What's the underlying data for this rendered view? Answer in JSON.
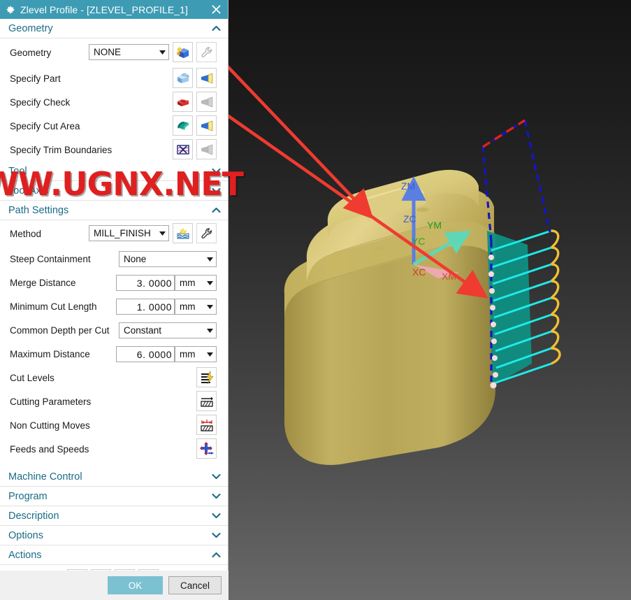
{
  "window": {
    "title": "Zlevel Profile - [ZLEVEL_PROFILE_1]",
    "gear_icon": "gear-icon",
    "close_icon": "close-icon",
    "titlebar_color": "#3d9bb4"
  },
  "watermark": {
    "text": "WW.UGNX.NET",
    "color": "#e01f1f"
  },
  "groups": {
    "geometry": {
      "label": "Geometry",
      "expanded": true,
      "chevron": "chevron-up-icon",
      "geometry_row": {
        "label": "Geometry",
        "value": "NONE",
        "edit_icon": "edit-geometry-icon",
        "wrench_icon": "wrench-icon"
      },
      "specify_rows": [
        {
          "label": "Specify Part",
          "select_icon": "part-body-icon",
          "display_icon": "flashlight-icon",
          "enabled": true
        },
        {
          "label": "Specify Check",
          "select_icon": "check-body-icon",
          "display_icon": "flashlight-icon",
          "enabled": false
        },
        {
          "label": "Specify Cut Area",
          "select_icon": "cut-area-icon",
          "display_icon": "flashlight-icon",
          "enabled": true
        },
        {
          "label": "Specify Trim Boundaries",
          "select_icon": "trim-boundary-icon",
          "display_icon": "flashlight-icon",
          "enabled": false
        }
      ]
    },
    "tool": {
      "label": "Tool",
      "expanded": false,
      "chevron": "chevron-down-icon"
    },
    "tool_axis": {
      "label": "Tool Axis",
      "expanded": false,
      "chevron": "chevron-down-icon"
    },
    "path_settings": {
      "label": "Path Settings",
      "expanded": true,
      "chevron": "chevron-up-icon",
      "method": {
        "label": "Method",
        "value": "MILL_FINISH",
        "edit_icon": "edit-method-icon",
        "wrench_icon": "wrench-icon"
      },
      "fields": [
        {
          "label": "Steep Containment",
          "type": "combo",
          "value": "None"
        },
        {
          "label": "Merge Distance",
          "type": "number",
          "value": "3. 0000",
          "unit": "mm"
        },
        {
          "label": "Minimum Cut Length",
          "type": "number",
          "value": "1. 0000",
          "unit": "mm"
        },
        {
          "label": "Common Depth per Cut",
          "type": "combo",
          "value": "Constant"
        },
        {
          "label": "Maximum Distance",
          "type": "number",
          "value": "6. 0000",
          "unit": "mm"
        }
      ],
      "buttons": [
        {
          "label": "Cut Levels",
          "icon": "cut-levels-icon"
        },
        {
          "label": "Cutting Parameters",
          "icon": "cutting-parameters-icon"
        },
        {
          "label": "Non Cutting Moves",
          "icon": "non-cutting-moves-icon"
        },
        {
          "label": "Feeds and Speeds",
          "icon": "feeds-and-speeds-icon"
        }
      ]
    },
    "machine_control": {
      "label": "Machine Control",
      "expanded": false,
      "chevron": "chevron-down-icon"
    },
    "program": {
      "label": "Program",
      "expanded": false,
      "chevron": "chevron-down-icon"
    },
    "description": {
      "label": "Description",
      "expanded": false,
      "chevron": "chevron-down-icon"
    },
    "options": {
      "label": "Options",
      "expanded": false,
      "chevron": "chevron-down-icon"
    },
    "actions": {
      "label": "Actions",
      "expanded": true,
      "chevron": "chevron-up-icon",
      "icons": [
        {
          "name": "generate-icon"
        },
        {
          "name": "replay-icon"
        },
        {
          "name": "verify-icon"
        },
        {
          "name": "list-icon"
        }
      ]
    }
  },
  "footer": {
    "ok_label": "OK",
    "cancel_label": "Cancel"
  },
  "viewport": {
    "csys_labels": [
      {
        "text": "ZM",
        "color": "#3b5fd0"
      },
      {
        "text": "ZC",
        "color": "#3b5fd0"
      },
      {
        "text": "YM",
        "color": "#19a020"
      },
      {
        "text": "YC",
        "color": "#19a020"
      },
      {
        "text": "XC",
        "color": "#d03b2f"
      },
      {
        "text": "XM",
        "color": "#d03b2f"
      }
    ],
    "colors": {
      "part": "#d8c36a",
      "cut_area": "#0e8f82",
      "cut_pass": "#21e8e8",
      "engage_retract": "#f0c032",
      "rapid": "#1515c8",
      "approach": "#e02020",
      "annotation_arrow": "#ef3b30"
    },
    "toolpath": {
      "cut_pass_count": 9,
      "rapid_style": "dashed",
      "engage_style": "arc"
    }
  }
}
